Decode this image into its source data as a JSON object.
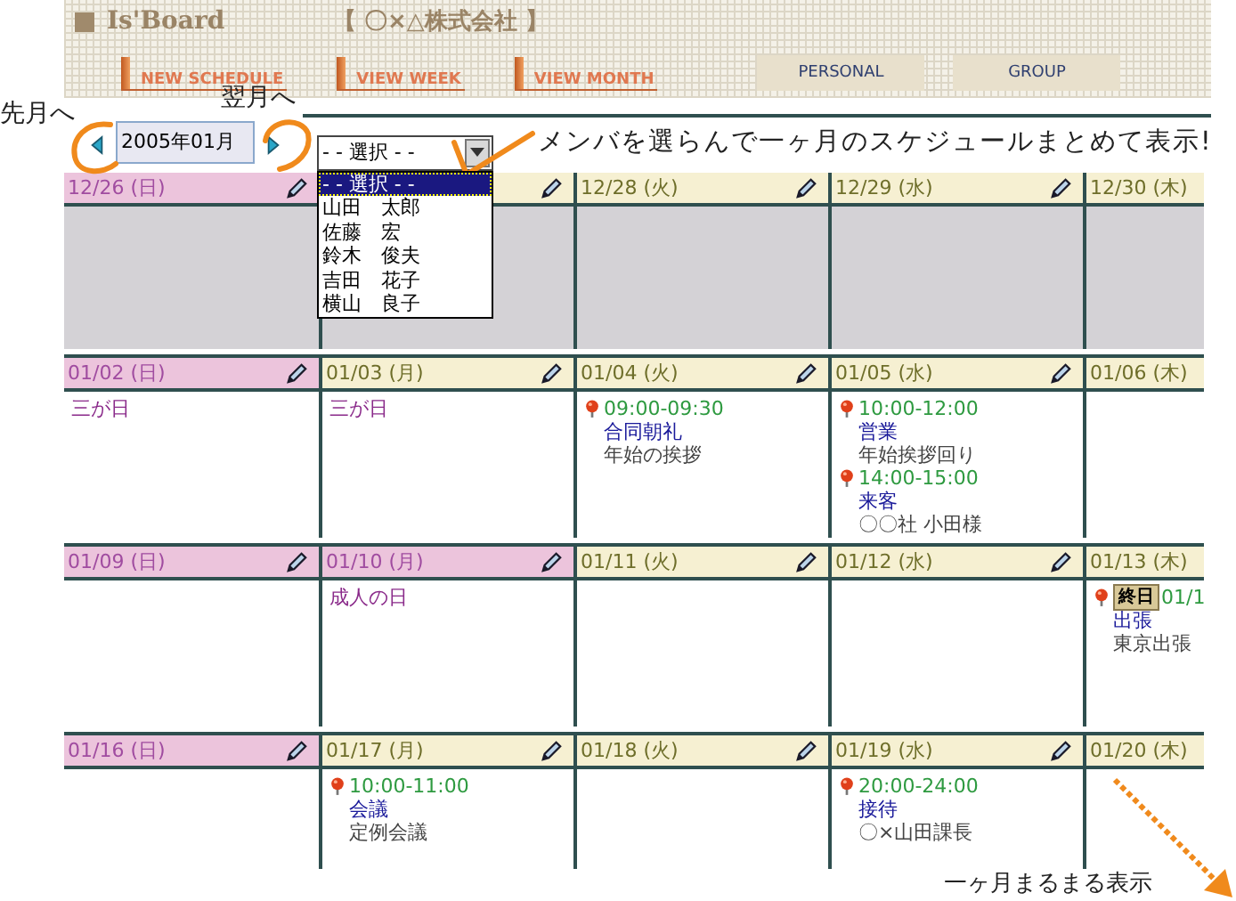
{
  "header": {
    "logo": "Is'Board",
    "company": "【 〇×△株式会社 】",
    "nav": [
      {
        "label": "NEW SCHEDULE",
        "kind": "link"
      },
      {
        "label": "VIEW WEEK",
        "kind": "link"
      },
      {
        "label": "VIEW MONTH",
        "kind": "link"
      },
      {
        "label": "PERSONAL",
        "kind": "button"
      },
      {
        "label": "GROUP",
        "kind": "button"
      }
    ]
  },
  "month_nav": {
    "prev_note": "先月へ",
    "next_note": "翌月へ",
    "month": "2005年01月"
  },
  "member_select": {
    "value": "- - 選択 - -",
    "expanded": true,
    "note": "メンバを選らんで一ヶ月のスケジュールまとめて表示!",
    "options": [
      {
        "label": "- - 選択 - -",
        "selected": true
      },
      {
        "label": "山田　太郎",
        "selected": false
      },
      {
        "label": "佐藤　宏",
        "selected": false
      },
      {
        "label": "鈴木　俊夫",
        "selected": false
      },
      {
        "label": "吉田　花子",
        "selected": false
      },
      {
        "label": "横山　良子",
        "selected": false
      }
    ]
  },
  "weeks": [
    {
      "days": [
        {
          "date": "12/26 (日)",
          "holiday": true,
          "other_month": true
        },
        {
          "holiday": false,
          "other_month": true
        },
        {
          "date": "12/28 (火)",
          "holiday": false,
          "other_month": true
        },
        {
          "date": "12/29 (水)",
          "holiday": false,
          "other_month": true
        },
        {
          "date": "12/30 (木)",
          "holiday": false,
          "other_month": true
        }
      ]
    },
    {
      "days": [
        {
          "date": "01/02 (日)",
          "holiday": true,
          "other_month": false,
          "holiday_name": "三が日"
        },
        {
          "date": "01/03 (月)",
          "holiday": false,
          "other_month": false,
          "holiday_name": "三が日"
        },
        {
          "date": "01/04 (火)",
          "holiday": false,
          "other_month": false,
          "events": [
            {
              "time": "09:00-09:30",
              "title": "合同朝礼",
              "note": "年始の挨拶"
            }
          ]
        },
        {
          "date": "01/05 (水)",
          "holiday": false,
          "other_month": false,
          "events": [
            {
              "time": "10:00-12:00",
              "title": "営業",
              "note": "年始挨拶回り"
            },
            {
              "time": "14:00-15:00",
              "title": "来客",
              "note": "〇〇社 小田様"
            }
          ]
        },
        {
          "date": "01/06 (木)",
          "holiday": false,
          "other_month": false
        }
      ]
    },
    {
      "days": [
        {
          "date": "01/09 (日)",
          "holiday": true,
          "other_month": false
        },
        {
          "date": "01/10 (月)",
          "holiday": true,
          "other_month": false,
          "holiday_name": "成人の日"
        },
        {
          "date": "01/11 (火)",
          "holiday": false,
          "other_month": false
        },
        {
          "date": "01/12 (水)",
          "holiday": false,
          "other_month": false
        },
        {
          "date": "01/13 (木)",
          "holiday": false,
          "other_month": false,
          "events": [
            {
              "badge": "終日",
              "time": "01/1",
              "title": "出張",
              "note": "東京出張"
            }
          ]
        }
      ]
    },
    {
      "days": [
        {
          "date": "01/16 (日)",
          "holiday": true,
          "other_month": false
        },
        {
          "date": "01/17 (月)",
          "holiday": false,
          "other_month": false,
          "events": [
            {
              "time": "10:00-11:00",
              "title": "会議",
              "note": "定例会議"
            }
          ]
        },
        {
          "date": "01/18 (火)",
          "holiday": false,
          "other_month": false
        },
        {
          "date": "01/19 (水)",
          "holiday": false,
          "other_month": false,
          "events": [
            {
              "time": "20:00-24:00",
              "title": "接待",
              "note": "〇×山田課長"
            }
          ]
        },
        {
          "date": "01/20 (木)",
          "holiday": false,
          "other_month": false
        }
      ]
    }
  ],
  "bottom_note": "一ヶ月まるまる表示"
}
